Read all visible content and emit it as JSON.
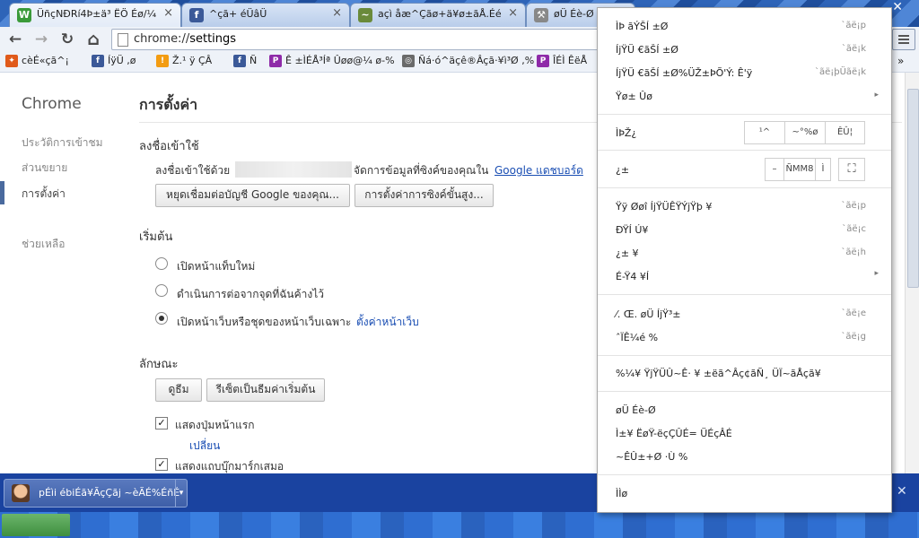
{
  "tabs": [
    {
      "title": "ÜñçNÐRí4Þ±ä³ ËÖ Éø/¼1 ⁱ",
      "icon_color": "#3a9a3a",
      "icon_glyph": "W"
    },
    {
      "title": "^çã+ éÜâÜ",
      "icon_color": "#3b5998",
      "icon_glyph": "f"
    },
    {
      "title": "açì åæ^Çãø+ä¥ø±ãÅ.Ééé",
      "icon_color": "#6a8a3a",
      "icon_glyph": "~"
    },
    {
      "title": "øÜ Éè-Ø",
      "icon_color": "#888888",
      "icon_glyph": "⚒"
    }
  ],
  "tab_close_glyph": "×",
  "window_close_glyph": "✕",
  "toolbar": {
    "back_icon": "←",
    "forward_icon": "→",
    "reload_icon": "↻",
    "home_icon": "⌂",
    "url_scheme": "chrome://",
    "url_host": "settings"
  },
  "bookmarks": [
    {
      "label": "cèÉ«çã^¡",
      "icon_color": "#e05a1a",
      "icon_glyph": "✦"
    },
    {
      "label": "ÍÿÜ ,ø",
      "icon_color": "#3b5998",
      "icon_glyph": "f"
    },
    {
      "label": "Ž.¹ ÿ ÇÂ",
      "icon_color": "#f39c12",
      "icon_glyph": "!"
    },
    {
      "label": "Ñ",
      "icon_color": "#3b5998",
      "icon_glyph": "f"
    },
    {
      "label": "Ê ±ÌÉÅ³Íª Ûøø@¼ ø-%",
      "icon_color": "#8e2aa8",
      "icon_glyph": "P"
    },
    {
      "label": "Ñá·ó^äçê®Âçã·¥ì³Ø ,%",
      "icon_color": "#6a6a6a",
      "icon_glyph": "◎"
    },
    {
      "label": "ÎÉÌ ÊëÅ",
      "icon_color": "#8e2aa8",
      "icon_glyph": "P"
    }
  ],
  "bookmarks_overflow": "»",
  "sidebar": {
    "brand": "Chrome",
    "items": [
      {
        "label": "ประวัติการเข้าชม"
      },
      {
        "label": "ส่วนขยาย"
      },
      {
        "label": "การตั้งค่า"
      },
      {
        "label": "ช่วยเหลือ"
      }
    ]
  },
  "settings": {
    "title": "การตั้งค่า",
    "signin": {
      "heading": "ลงชื่อเข้าใช้",
      "text_before": "ลงชื่อเข้าใช้ด้วย",
      "text_after": "จัดการข้อมูลที่ซิงค์ของคุณใน",
      "dashboard_link": "Google แดชบอร์ด",
      "disconnect_button": "หยุดเชื่อมต่อบัญชี Google ของคุณ...",
      "advanced_sync_button": "การตั้งค่าการซิงค์ขั้นสูง..."
    },
    "startup": {
      "heading": "เริ่มต้น",
      "options": [
        {
          "label": "เปิดหน้าแท็บใหม่",
          "selected": false
        },
        {
          "label": "ดำเนินการต่อจากจุดที่ฉันค้างไว้",
          "selected": false
        },
        {
          "label": "เปิดหน้าเว็บหรือชุดของหน้าเว็บเฉพาะ",
          "selected": true
        }
      ],
      "set_pages_link": "ตั้งค่าหน้าเว็บ"
    },
    "appearance": {
      "heading": "ลักษณะ",
      "themes_button": "ดูธีม",
      "reset_theme_button": "รีเซ็ตเป็นธีมค่าเริ่มต้น",
      "show_home_button": {
        "label": "แสดงปุ่มหน้าแรก",
        "checked": true
      },
      "change_link": "เปลี่ยน",
      "show_bookmarks_bar": {
        "label": "แสดงแถบบุ๊กมาร์กเสมอ",
        "checked": true
      }
    }
  },
  "download_shelf": {
    "item_name": "pÉìi ébiÉã¥ÃçÇãj ~èÃÉ%ÉñÉ",
    "close_glyph": "✕"
  },
  "menu": {
    "items_top": [
      {
        "label": "ÌÞ ãÝŠÍ ±Ø",
        "shortcut": "`ãë¡p"
      },
      {
        "label": "ÍjŸÜ €ãŠÍ ±Ø",
        "shortcut": "`ãë¡k"
      },
      {
        "label": "ÍjŸÜ €ãŠÍ ±Ø%ÜŽ±ÞÕ'Ý: Ê'ÿ",
        "shortcut": "`ãë¡þÜãë¡k"
      },
      {
        "label": "Ÿø± Ûø",
        "shortcut": ""
      }
    ],
    "more_tools_has_submenu": true,
    "zoom": {
      "label": "ÌÞŽ¿",
      "minus": "¹^",
      "value": "~°%ø",
      "fullscreen": "ÊÛ¦"
    },
    "edit": {
      "label": "¿±",
      "minus": "–",
      "value": "ÑMM8",
      "plus": "Ì"
    },
    "items_mid": [
      {
        "label": "Ÿÿ Øøî ÍjŸÜÊŸÝjŸþ ¥",
        "shortcut": "`ãë¡p"
      },
      {
        "label": "ÐŸÍ Ú¥",
        "shortcut": "`ãë¡c"
      },
      {
        "label": "¿± ¥",
        "shortcut": "`ãë¡h"
      },
      {
        "label": "É-Ÿ4 ¥Í",
        "shortcut": ""
      }
    ],
    "items_low": [
      {
        "label": "⁄. Œ. øÜ ÍjŸ³±",
        "shortcut": "`ãë¡e"
      },
      {
        "label": "ˆÏÊ¼é %",
        "shortcut": "`ãë¡g"
      }
    ],
    "signin_item": "%¼¥ ŸjŸÜÛ~Ê· ¥ ±ëã^Âç¢ãÑ¸ ÜÏ~ãÅçã¥",
    "items_bottom": [
      {
        "label": "øÜ Éè-Ø"
      },
      {
        "label": "Ì±¥ ËøŸ-ëçÇÛÉ= ÜÉçÂÉ"
      },
      {
        "label": "~ÊÛ±+Ø ·Ù %"
      }
    ],
    "exit": "ÌÌø",
    "submenu_glyph": "▸"
  }
}
